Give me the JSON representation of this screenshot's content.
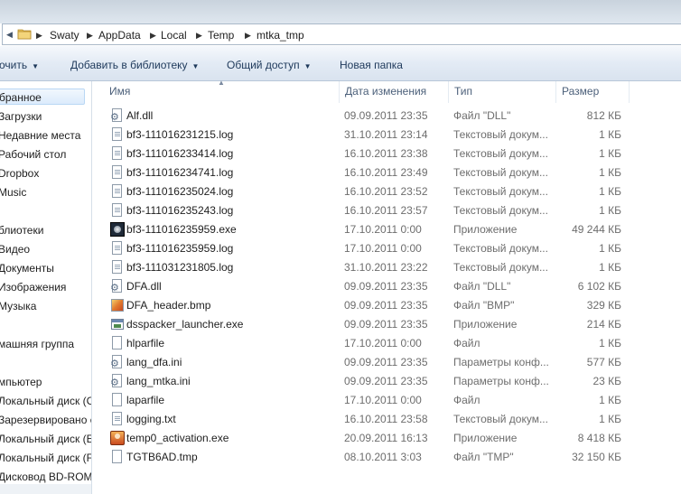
{
  "address": {
    "crumbs": [
      "Swaty",
      "AppData",
      "Local",
      "Temp",
      "mtka_tmp"
    ]
  },
  "toolbar": {
    "organize_label": "очить",
    "add_library_label": "Добавить в библиотеку",
    "share_label": "Общий доступ",
    "new_folder_label": "Новая папка"
  },
  "nav": {
    "items": [
      "бранное",
      "Загрузки",
      "Недавние места",
      "Рабочий стол",
      "Dropbox",
      "Music",
      "блиотеки",
      "Видео",
      "Документы",
      "Изображения",
      "Музыка",
      "машняя группа",
      "мпьютер",
      "Локальный диск (C",
      "Зарезервировано с",
      "Локальный диск (E:",
      "Локальный диск (F:",
      "Дисковод BD-ROM"
    ]
  },
  "columns": {
    "name": "Имя",
    "date": "Дата изменения",
    "type": "Тип",
    "size": "Размер"
  },
  "files": [
    {
      "icon": "dll-file-icon",
      "name": "Alf.dll",
      "date": "09.09.2011 23:35",
      "type": "Файл \"DLL\"",
      "size": "812 КБ"
    },
    {
      "icon": "text-file-icon",
      "name": "bf3-111016231215.log",
      "date": "31.10.2011 23:14",
      "type": "Текстовый докум...",
      "size": "1 КБ"
    },
    {
      "icon": "text-file-icon",
      "name": "bf3-111016233414.log",
      "date": "16.10.2011 23:38",
      "type": "Текстовый докум...",
      "size": "1 КБ"
    },
    {
      "icon": "text-file-icon",
      "name": "bf3-111016234741.log",
      "date": "16.10.2011 23:49",
      "type": "Текстовый докум...",
      "size": "1 КБ"
    },
    {
      "icon": "text-file-icon",
      "name": "bf3-111016235024.log",
      "date": "16.10.2011 23:52",
      "type": "Текстовый докум...",
      "size": "1 КБ"
    },
    {
      "icon": "text-file-icon",
      "name": "bf3-111016235243.log",
      "date": "16.10.2011 23:57",
      "type": "Текстовый докум...",
      "size": "1 КБ"
    },
    {
      "icon": "application-icon",
      "name": "bf3-111016235959.exe",
      "date": "17.10.2011 0:00",
      "type": "Приложение",
      "size": "49 244 КБ"
    },
    {
      "icon": "text-file-icon",
      "name": "bf3-111016235959.log",
      "date": "17.10.2011 0:00",
      "type": "Текстовый докум...",
      "size": "1 КБ"
    },
    {
      "icon": "text-file-icon",
      "name": "bf3-111031231805.log",
      "date": "31.10.2011 23:22",
      "type": "Текстовый докум...",
      "size": "1 КБ"
    },
    {
      "icon": "dll-file-icon",
      "name": "DFA.dll",
      "date": "09.09.2011 23:35",
      "type": "Файл \"DLL\"",
      "size": "6 102 КБ"
    },
    {
      "icon": "bitmap-file-icon",
      "name": "DFA_header.bmp",
      "date": "09.09.2011 23:35",
      "type": "Файл \"BMP\"",
      "size": "329 КБ"
    },
    {
      "icon": "window-exe-icon",
      "name": "dsspacker_launcher.exe",
      "date": "09.09.2011 23:35",
      "type": "Приложение",
      "size": "214 КБ"
    },
    {
      "icon": "blank-file-icon",
      "name": "hlparfile",
      "date": "17.10.2011 0:00",
      "type": "Файл",
      "size": "1 КБ"
    },
    {
      "icon": "config-file-icon",
      "name": "lang_dfa.ini",
      "date": "09.09.2011 23:35",
      "type": "Параметры конф...",
      "size": "577 КБ"
    },
    {
      "icon": "config-file-icon",
      "name": "lang_mtka.ini",
      "date": "09.09.2011 23:35",
      "type": "Параметры конф...",
      "size": "23 КБ"
    },
    {
      "icon": "blank-file-icon",
      "name": "laparfile",
      "date": "17.10.2011 0:00",
      "type": "Файл",
      "size": "1 КБ"
    },
    {
      "icon": "text-file-icon",
      "name": "logging.txt",
      "date": "16.10.2011 23:58",
      "type": "Текстовый докум...",
      "size": "1 КБ"
    },
    {
      "icon": "activation-app-icon",
      "name": "temp0_activation.exe",
      "date": "20.09.2011 16:13",
      "type": "Приложение",
      "size": "8 418 КБ"
    },
    {
      "icon": "blank-file-icon",
      "name": "TGTB6AD.tmp",
      "date": "08.10.2011 3:03",
      "type": "Файл \"TMP\"",
      "size": "32 150 КБ"
    }
  ],
  "colors": {
    "toolbar_text": "#1e395b",
    "header_text": "#4c607a",
    "secondary_text": "#6d6d6d",
    "selection_border": "#b9d7f4"
  }
}
